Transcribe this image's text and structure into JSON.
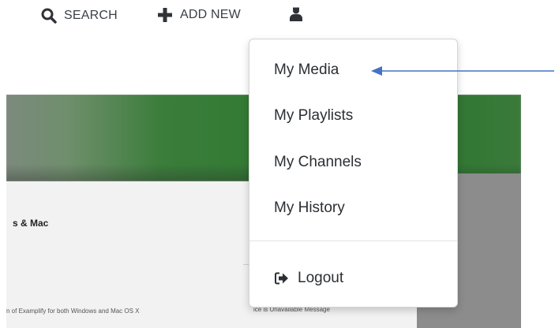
{
  "topnav": {
    "search": {
      "label": "SEARCH",
      "icon": "search-icon"
    },
    "add_new": {
      "label": "ADD NEW",
      "icon": "plus-icon"
    },
    "user": {
      "icon": "user-icon"
    }
  },
  "background": {
    "title_fragment": "s & Mac",
    "subtitle_fragment": "n of Examplify for both Windows and Mac OS X",
    "message_fragment": "ice is Unavailable Message"
  },
  "dropdown": {
    "items": [
      {
        "label": "My Media"
      },
      {
        "label": "My Playlists"
      },
      {
        "label": "My Channels"
      },
      {
        "label": "My History"
      }
    ],
    "logout": {
      "label": "Logout",
      "icon": "sign-out-icon"
    }
  },
  "annotation": {
    "color": "#4472c4",
    "points_to": "My Media"
  },
  "colors": {
    "nav_text": "#3a3f45",
    "menu_text": "#2b2f33",
    "header_green": "#2f7a31"
  }
}
